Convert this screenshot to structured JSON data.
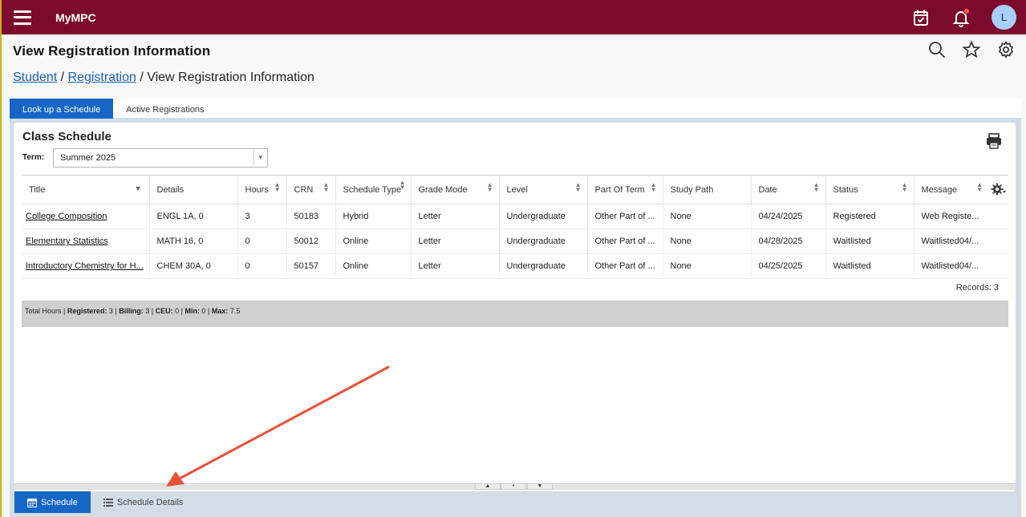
{
  "topbar": {
    "app_name": "MyMPC",
    "avatar_initial": "L",
    "brand_color": "#7b0a2e"
  },
  "header": {
    "title": "View Registration Information"
  },
  "breadcrumb": {
    "items": [
      "Student",
      "Registration"
    ],
    "separator": " / ",
    "current": "View Registration Information"
  },
  "tabs": [
    {
      "label": "Look up a Schedule",
      "active": true
    },
    {
      "label": "Active Registrations",
      "active": false
    }
  ],
  "schedule": {
    "title": "Class Schedule",
    "term_label": "Term:",
    "term_value": "Summer 2025",
    "columns": [
      "Title",
      "Details",
      "Hours",
      "CRN",
      "Schedule Type",
      "Grade Mode",
      "Level",
      "Part Of Term",
      "Study Path",
      "Date",
      "Status",
      "Message"
    ],
    "rows": [
      {
        "title": "College Composition",
        "details": "ENGL 1A, 0",
        "hours": "3",
        "crn": "50183",
        "schedule_type": "Hybrid",
        "grade_mode": "Letter",
        "level": "Undergraduate",
        "part_of_term": "Other Part of ...",
        "study_path": "None",
        "date": "04/24/2025",
        "status": "Registered",
        "message": "Web Registe..."
      },
      {
        "title": "Elementary Statistics",
        "details": "MATH 16, 0",
        "hours": "0",
        "crn": "50012",
        "schedule_type": "Online",
        "grade_mode": "Letter",
        "level": "Undergraduate",
        "part_of_term": "Other Part of ...",
        "study_path": "None",
        "date": "04/28/2025",
        "status": "Waitlisted",
        "message": "Waitlisted04/..."
      },
      {
        "title": "Introductory Chemistry for H...",
        "details": "CHEM 30A, 0",
        "hours": "0",
        "crn": "50157",
        "schedule_type": "Online",
        "grade_mode": "Letter",
        "level": "Undergraduate",
        "part_of_term": "Other Part of ...",
        "study_path": "None",
        "date": "04/25/2025",
        "status": "Waitlisted",
        "message": "Waitlisted04/..."
      }
    ],
    "records_text": "Records: 3",
    "summary": {
      "total_hours_label": "Total Hours",
      "registered_label": "Registered:",
      "registered": "3",
      "billing_label": "Billing:",
      "billing": "3",
      "ceu_label": "CEU:",
      "ceu": "0",
      "min_label": "Min:",
      "min": "0",
      "max_label": "Max:",
      "max": "7.5"
    }
  },
  "bottom_tabs": [
    {
      "label": "Schedule",
      "active": true,
      "icon": "calendar-icon"
    },
    {
      "label": "Schedule Details",
      "active": false,
      "icon": "list-icon"
    }
  ],
  "colors": {
    "accent": "#1566c6",
    "annotation_arrow": "#e8523a"
  }
}
